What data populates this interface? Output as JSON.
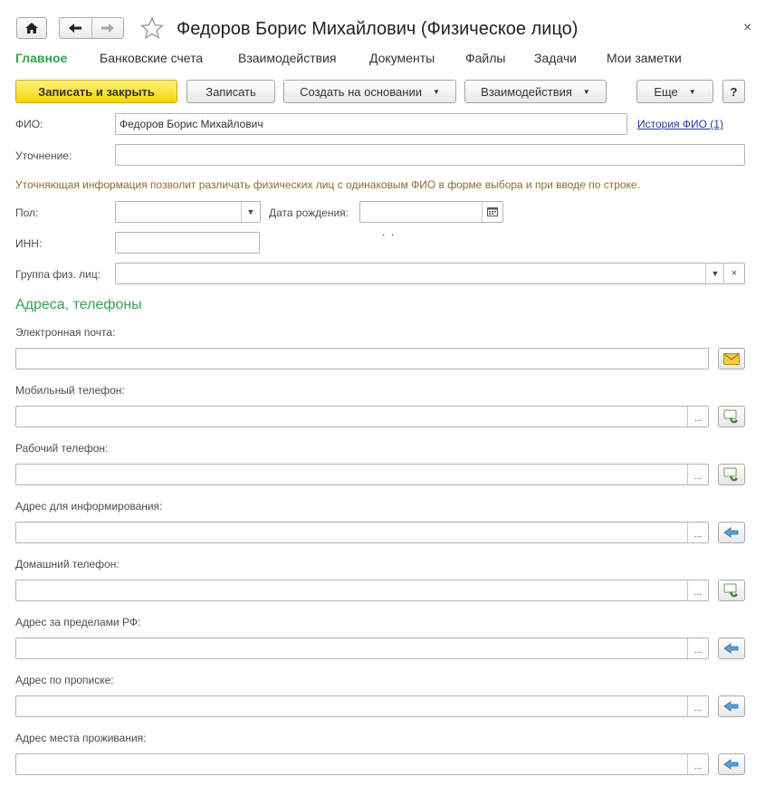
{
  "window": {
    "title": "Федоров Борис Михайлович (Физическое лицо)",
    "close_symbol": "×"
  },
  "icons": {
    "home": "home-icon",
    "back": "arrow-left-icon",
    "forward": "arrow-right-icon",
    "favorite": "star-icon",
    "close": "close-icon"
  },
  "tabs": [
    {
      "label": "Главное",
      "active": true
    },
    {
      "label": "Банковские счета"
    },
    {
      "label": "Взаимодействия"
    },
    {
      "label": "Документы"
    },
    {
      "label": "Файлы"
    },
    {
      "label": "Задачи"
    },
    {
      "label": "Мои заметки"
    }
  ],
  "toolbar": {
    "save_close": "Записать и закрыть",
    "save": "Записать",
    "create_based": "Создать на основании",
    "interactions": "Взаимодействия",
    "more": "Еще",
    "help": "?"
  },
  "form": {
    "fio_label": "ФИО:",
    "fio_value": "Федоров Борис Михайлович",
    "fio_history": "История ФИО (1)",
    "clarification_label": "Уточнение:",
    "clarification_value": "",
    "hint": "Уточняющая информация позволит различать физических лиц  с одинаковым ФИО в форме выбора и при вводе по строке.",
    "gender_label": "Пол:",
    "gender_value": "",
    "birth_label": "Дата рождения:",
    "birth_value": "  .  .",
    "inn_label": "ИНН:",
    "inn_value": "",
    "group_label": "Группа физ. лиц:",
    "group_value": ""
  },
  "contacts": {
    "section_title": "Адреса, телефоны",
    "email_label": "Электронная почта:",
    "mobile_label": "Мобильный телефон:",
    "work_phone_label": "Рабочий телефон:",
    "info_address_label": "Адрес для информирования:",
    "home_phone_label": "Домашний телефон:",
    "abroad_address_label": "Адрес за пределами РФ:",
    "registration_address_label": "Адрес по прописке:",
    "residence_address_label": "Адрес места проживания:",
    "ellipsis": "..."
  },
  "colors": {
    "accent_green": "#36a14c",
    "primary_yellow": "#f6d40a",
    "hint_brown": "#8c6b33",
    "link_blue": "#1d3d9c"
  }
}
